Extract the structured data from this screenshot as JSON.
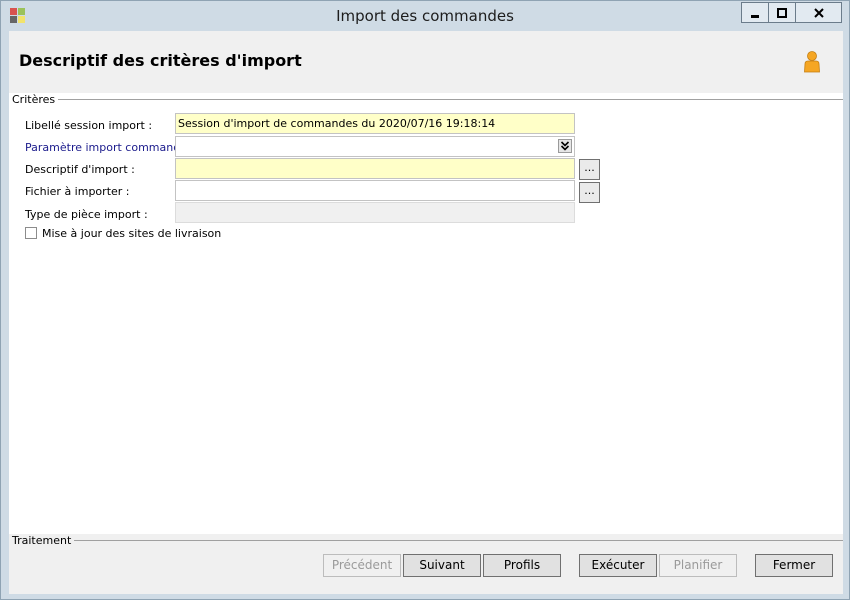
{
  "window": {
    "title": "Import des commandes"
  },
  "header": {
    "title": "Descriptif des critères d'import"
  },
  "criteria": {
    "section_label": "Critères",
    "libelle_label": "Libellé session import :",
    "libelle_value": "Session d'import de commandes du 2020/07/16 19:18:14",
    "parametre_label": "Paramètre import commande :",
    "parametre_value": "",
    "descriptif_label": "Descriptif d'import :",
    "descriptif_value": "",
    "fichier_label": "Fichier à importer :",
    "fichier_value": "",
    "type_label": "Type de pièce import :",
    "type_value": "",
    "browse_label": "...",
    "checkbox_label": "Mise à jour des sites de livraison",
    "checkbox_checked": false
  },
  "treatment": {
    "section_label": "Traitement",
    "precedent_label": "Précédent",
    "suivant_label": "Suivant",
    "profils_label": "Profils",
    "executer_label": "Exécuter",
    "planifier_label": "Planifier",
    "fermer_label": "Fermer"
  },
  "icons": {
    "app": "app-icon",
    "user": "user-icon",
    "dropdown": "double-chevron-down-icon"
  },
  "colors": {
    "required_field": "#ffffc8",
    "link_label": "#1b1b8c",
    "user_icon": "#f5a623"
  }
}
